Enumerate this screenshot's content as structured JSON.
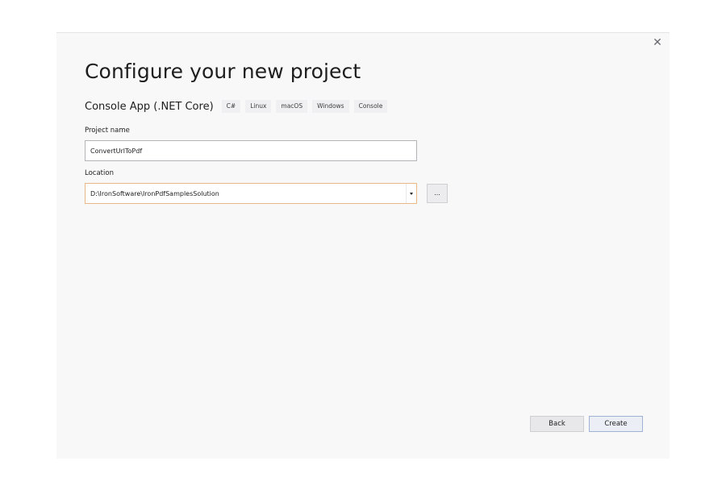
{
  "dialog": {
    "close_glyph": "✕",
    "title": "Configure your new project",
    "template": {
      "name": "Console App (.NET Core)",
      "tags": [
        "C#",
        "Linux",
        "macOS",
        "Windows",
        "Console"
      ]
    },
    "project_name": {
      "label": "Project name",
      "value": "ConvertUrlToPdf"
    },
    "location": {
      "label": "Location",
      "value": "D:\\IronSoftware\\IronPdfSamplesSolution",
      "browse_label": "..."
    },
    "buttons": {
      "back": "Back",
      "create": "Create"
    }
  },
  "colors": {
    "dialog_background": "#f8f8f9",
    "focused_border": "#e8b888",
    "primary_button_border": "#9fb2d4"
  },
  "icons": {
    "close": "close-icon",
    "dropdown": "chevron-down-icon"
  }
}
